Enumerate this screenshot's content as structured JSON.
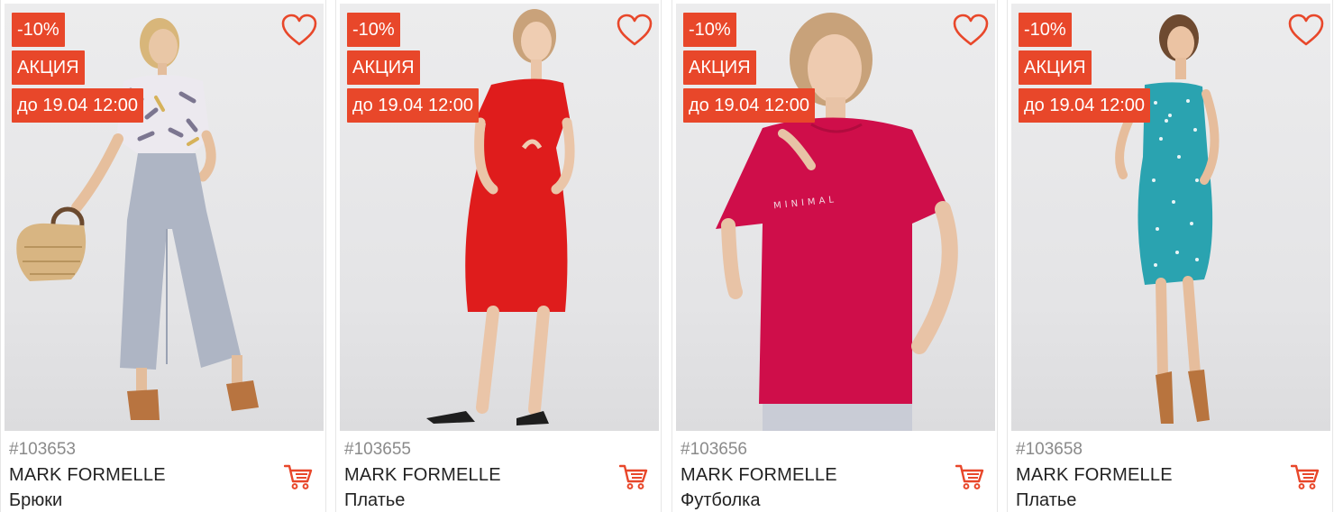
{
  "accent_color": "#e8472a",
  "products": [
    {
      "discount": "-10%",
      "promo": "АКЦИЯ",
      "deadline": "до 19.04 12:00",
      "sku": "#103653",
      "brand": "MARK FORMELLE",
      "type": "Брюки",
      "favorite_icon": "heart-outline-icon",
      "cart_icon": "cart-icon",
      "photo": "woman in floral blouse and grey wide-leg trousers with wicker bag"
    },
    {
      "discount": "-10%",
      "promo": "АКЦИЯ",
      "deadline": "до 19.04 12:00",
      "sku": "#103655",
      "brand": "MARK FORMELLE",
      "type": "Платье",
      "favorite_icon": "heart-outline-icon",
      "cart_icon": "cart-icon",
      "photo": "woman in red midi dress with cutout"
    },
    {
      "discount": "-10%",
      "promo": "АКЦИЯ",
      "deadline": "до 19.04 12:00",
      "sku": "#103656",
      "brand": "MARK FORMELLE",
      "type": "Футболка",
      "print": "MINIMAL",
      "favorite_icon": "heart-outline-icon",
      "cart_icon": "cart-icon",
      "photo": "woman in crimson t-shirt"
    },
    {
      "discount": "-10%",
      "promo": "АКЦИЯ",
      "deadline": "до 19.04 12:00",
      "sku": "#103658",
      "brand": "MARK FORMELLE",
      "type": "Платье",
      "favorite_icon": "heart-outline-icon",
      "cart_icon": "cart-icon",
      "photo": "woman in teal polka-dot slip dress"
    }
  ]
}
